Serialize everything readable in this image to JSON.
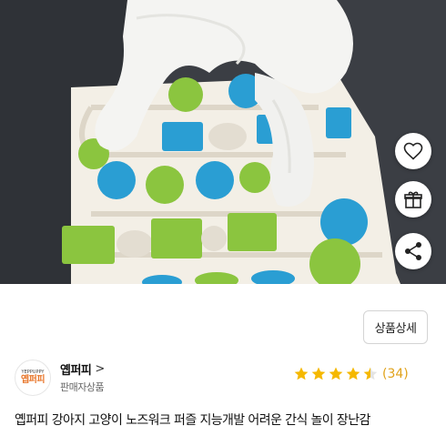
{
  "product": {
    "image_alt": "dog nose work puzzle toy",
    "detail_button": "상품상세",
    "title": "옙퍼피 강아지 고양이 노즈워크 퍼즐 지능개발 어려운 간식 놀이 장난감"
  },
  "actions": {
    "like_icon": "heart-icon",
    "gift_icon": "gift-icon",
    "share_icon": "share-icon"
  },
  "seller": {
    "name": "옙퍼피",
    "chevron": ">",
    "subtitle": "판매자상품",
    "logo_top": "YEPPUPPY",
    "logo_main": "옙퍼피"
  },
  "rating": {
    "value": 4.5,
    "max": 5,
    "count_label": "(34)",
    "star_color": "#f5b800"
  },
  "colors": {
    "text": "#111111",
    "subtext": "#666666",
    "puzzle_board": "#f3efe6",
    "green": "#8bc53f",
    "blue": "#2a9ed3"
  }
}
